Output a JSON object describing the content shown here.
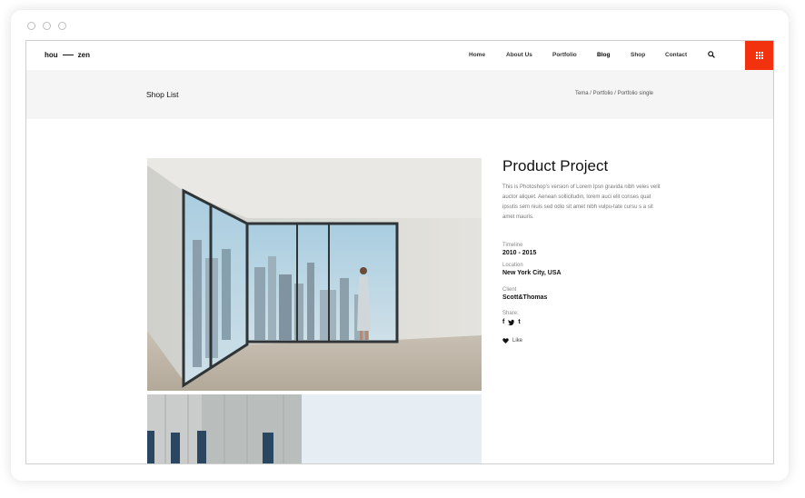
{
  "site": {
    "logo": {
      "left": "hou",
      "right": "zen"
    },
    "nav": [
      {
        "label": "Home",
        "active": false
      },
      {
        "label": "About Us",
        "active": false
      },
      {
        "label": "Portfolio",
        "active": false
      },
      {
        "label": "Blog",
        "active": true
      },
      {
        "label": "Shop",
        "active": false
      },
      {
        "label": "Contact",
        "active": false
      }
    ],
    "accent_color": "#f2310f"
  },
  "pagebar": {
    "title": "Shop List",
    "breadcrumb": "Tema / Portfolio / Portfolio single"
  },
  "product": {
    "title": "Product Project",
    "description": "This is Photoshop's version  of Lorem Ipsn gravida nibh veles velit auctor aliquet. Aenean sollicitudin, lorem auci elit conses quat ipsutis sem niuis sed odio sit amet nibh vulpu-tate cursu s a sit amet mauris.",
    "meta": [
      {
        "label": "Timeline",
        "value": "2010 - 2015"
      },
      {
        "label": "Location",
        "value": "New York City, USA"
      },
      {
        "label": "Client",
        "value": "Scott&Thomas"
      }
    ],
    "share_label": "Share:",
    "share_icons": [
      "facebook-icon",
      "twitter-icon",
      "tumblr-icon"
    ],
    "like_label": "Like"
  }
}
